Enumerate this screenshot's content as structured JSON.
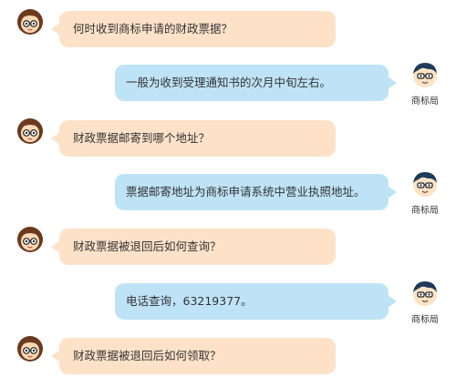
{
  "conversation": [
    {
      "side": "user",
      "text": "何时收到商标申请的财政票据？"
    },
    {
      "side": "agent",
      "text": "一般为收到受理通知书的次月中旬左右。",
      "agent_name": "商标局"
    },
    {
      "side": "user",
      "text": "财政票据邮寄到哪个地址？"
    },
    {
      "side": "agent",
      "text": "票据邮寄地址为商标申请系统中营业执照地址。",
      "agent_name": "商标局"
    },
    {
      "side": "user",
      "text": "财政票据被退回后如何查询？"
    },
    {
      "side": "agent",
      "text": "电话查询，63219377。",
      "agent_name": "商标局"
    },
    {
      "side": "user",
      "text": "财政票据被退回后如何领取？"
    }
  ],
  "colors": {
    "user_bubble": "#fde2c8",
    "agent_bubble": "#bfe3f6"
  },
  "icons": {
    "user_avatar": "girl-with-glasses-icon",
    "agent_avatar": "boy-with-glasses-icon"
  }
}
